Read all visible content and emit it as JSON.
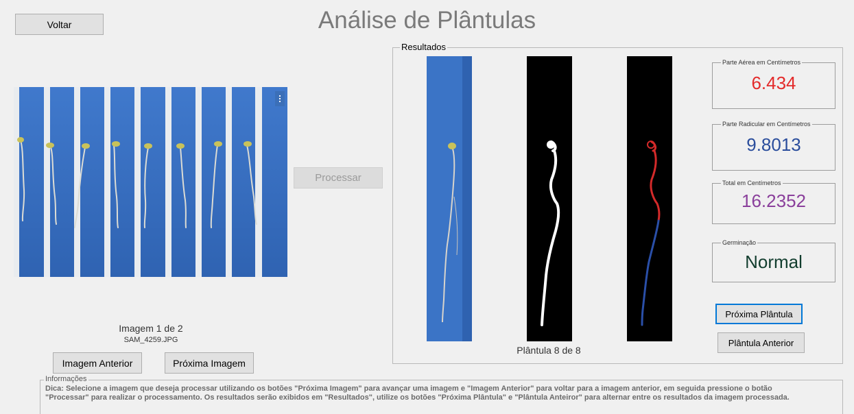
{
  "header": {
    "title": "Análise de Plântulas",
    "back_label": "Voltar"
  },
  "left_panel": {
    "image_counter": "Imagem 1 de 2",
    "filename": "SAM_4259.JPG",
    "prev_image_label": "Imagem Anterior",
    "next_image_label": "Próxima Imagem"
  },
  "process_label": "Processar",
  "results": {
    "legend": "Resultados",
    "seedling_counter": "Plântula 8 de 8",
    "metrics": [
      {
        "label": "Parte Aérea em Centímetros",
        "value": "6.434",
        "color": "#e32a2a"
      },
      {
        "label": "Parte Radicular em Centímetros",
        "value": "9.8013",
        "color": "#2a4d9c"
      },
      {
        "label": "Total em Centímetros",
        "value": "16.2352",
        "color": "#8a3f9b"
      },
      {
        "label": "Germinação",
        "value": "Normal",
        "color": "#123d2e"
      }
    ],
    "next_seedling_label": "Próxima Plântula",
    "prev_seedling_label": "Plântula Anterior"
  },
  "info": {
    "legend": "Informações",
    "text": "Dica: Selecione a imagem que deseja processar utilizando os botões \"Próxima Imagem\" para avançar uma imagem e \"Imagem Anterior\" para voltar para a imagem anterior, em seguida pressione o botão \"Processar\" para realizar o processamento. Os resultados serão exibidos em \"Resultados\", utilize os botões \"Próxima Plântula\" e \"Plântula Anteiror\" para alternar entre os resultados da imagem processada."
  },
  "colors": {
    "photo_blue": "#3a73c4",
    "aerial_red": "#d42a2a",
    "root_blue": "#2a4fa8"
  },
  "icons": [
    "more-options-icon"
  ]
}
